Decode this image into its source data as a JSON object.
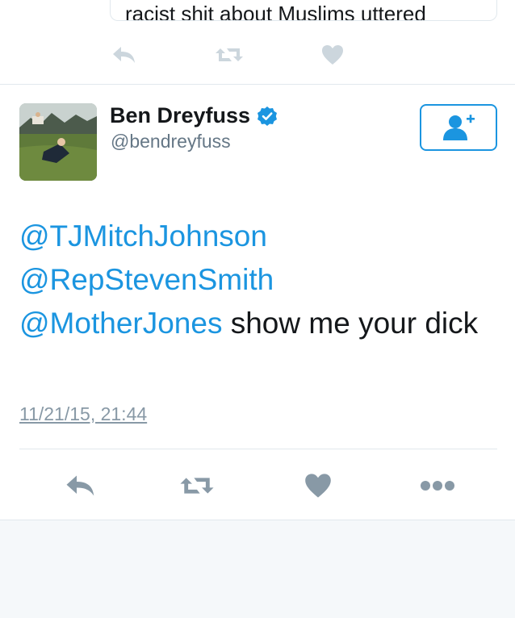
{
  "previous_tweet": {
    "quote_text": "racist shit about Muslims uttered",
    "actions": {
      "reply_icon": "reply-icon",
      "retweet_icon": "retweet-icon",
      "like_icon": "heart-icon"
    }
  },
  "tweet": {
    "author": {
      "name": "Ben Dreyfuss",
      "handle": "@bendreyfuss",
      "verified": true
    },
    "follow_icon": "follow-user-icon",
    "text": {
      "mention1": "@TJMitchJohnson",
      "mention2": "@RepStevenSmith",
      "mention3": "@MotherJones",
      "body": " show me your dick"
    },
    "timestamp": "11/21/15, 21:44",
    "actions": {
      "reply_icon": "reply-icon",
      "retweet_icon": "retweet-icon",
      "like_icon": "heart-icon",
      "more_icon": "more-icon"
    }
  },
  "colors": {
    "accent": "#1b95e0",
    "text": "#14171a",
    "secondary": "#657786",
    "icon_inactive": "#aab8c2",
    "icon_active": "#8899a6",
    "divider": "#e1e8ed",
    "background_bottom": "#f5f8fa"
  }
}
